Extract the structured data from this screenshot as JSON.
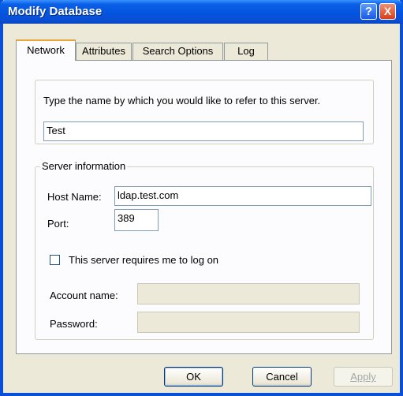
{
  "window": {
    "title": "Modify Database",
    "help_symbol": "?",
    "close_symbol": "X"
  },
  "tabs": [
    {
      "label": "Network",
      "active": true
    },
    {
      "label": "Attributes",
      "active": false
    },
    {
      "label": "Search Options",
      "active": false
    },
    {
      "label": "Log",
      "active": false
    }
  ],
  "network": {
    "prompt": "Type the name by which you would like to refer to this server.",
    "display_name": "Test",
    "server_info_legend": "Server information",
    "host_name_label": "Host Name:",
    "host_name_value": "ldap.test.com",
    "port_label": "Port:",
    "port_value": "389",
    "require_logon_label": "This server requires me to log on",
    "require_logon_checked": false,
    "account_name_label": "Account name:",
    "account_name_value": "",
    "password_label": "Password:",
    "password_value": ""
  },
  "buttons": {
    "ok": "OK",
    "cancel": "Cancel",
    "apply": "Apply"
  },
  "colors": {
    "titlebar": "#0454e0",
    "dialog_face": "#ece9d8",
    "active_tab_highlight": "#e7a53a"
  }
}
